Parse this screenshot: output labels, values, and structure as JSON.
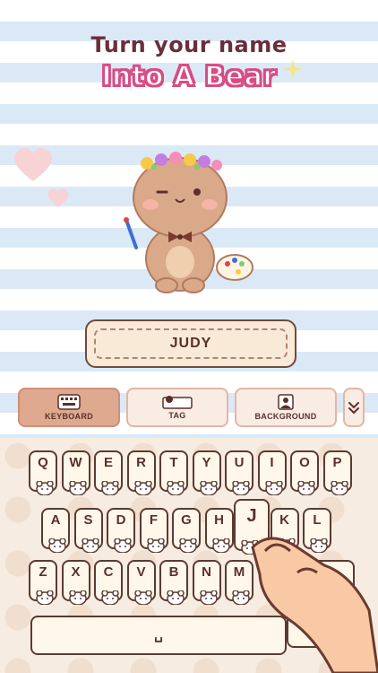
{
  "header": {
    "line1": "Turn your name",
    "line2": "Into A Bear"
  },
  "name_field": {
    "value": "JUDY"
  },
  "tabs": [
    {
      "label": "KEYBOARD",
      "icon": "keyboard-icon",
      "active": true
    },
    {
      "label": "TAG",
      "icon": "tag-icon",
      "active": false
    },
    {
      "label": "BACKGROUND",
      "icon": "background-image-icon",
      "active": false
    }
  ],
  "expand_icon": "double-chevron-down-icon",
  "keyboard": {
    "row1": [
      "Q",
      "W",
      "E",
      "R",
      "T",
      "Y",
      "U",
      "I",
      "O",
      "P"
    ],
    "row2": [
      "A",
      "S",
      "D",
      "F",
      "G",
      "H",
      "J",
      "K",
      "L"
    ],
    "row3": [
      "Z",
      "X",
      "C",
      "V",
      "B",
      "N",
      "M"
    ],
    "pressed_key": "J",
    "space_label": "␣"
  },
  "colors": {
    "accent_pink": "#d84c86",
    "title_brown": "#6a2f3a",
    "key_border": "#5c3a32",
    "active_tab": "#dea98e"
  }
}
